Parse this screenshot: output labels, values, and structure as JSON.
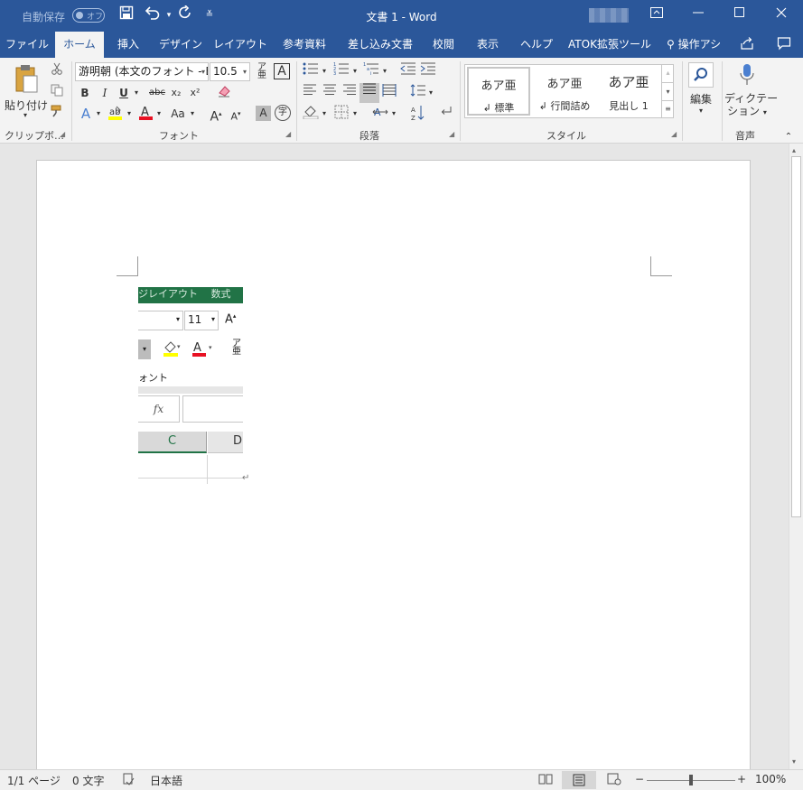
{
  "titlebar": {
    "autosave_label": "自動保存",
    "autosave_state": "オフ",
    "title": "文書 1  -  Word",
    "icons": {
      "save": "save-icon",
      "undo": "undo-icon",
      "redo": "redo-icon",
      "customize": "customize-quick-access-icon",
      "ribbon_display": "ribbon-display-options-icon",
      "minimize": "minimize-icon",
      "maximize": "maximize-icon",
      "close": "close-icon"
    }
  },
  "tabs": [
    {
      "label": "ファイル"
    },
    {
      "label": "ホーム",
      "active": true
    },
    {
      "label": "挿入"
    },
    {
      "label": "デザイン"
    },
    {
      "label": "レイアウト"
    },
    {
      "label": "参考資料"
    },
    {
      "label": "差し込み文書"
    },
    {
      "label": "校閲"
    },
    {
      "label": "表示"
    },
    {
      "label": "ヘルプ"
    },
    {
      "label": "ATOK拡張ツール"
    },
    {
      "label": "操作アシ"
    }
  ],
  "ribbon": {
    "clipboard": {
      "paste_label": "貼り付け",
      "group_label": "クリップボ…"
    },
    "font": {
      "font_name": "游明朝 (本文のフォント - E",
      "font_size": "10.5",
      "group_label": "フォント",
      "bold": "B",
      "italic": "I",
      "underline": "U",
      "strike": "abc",
      "subscript": "x₂",
      "superscript": "x²",
      "change_case": "Aa",
      "grow": "A",
      "shrink": "A",
      "char_border": "A",
      "enclose": "字"
    },
    "paragraph": {
      "group_label": "段落"
    },
    "styles": {
      "group_label": "スタイル",
      "items": [
        {
          "sample": "あア亜",
          "label": "↲ 標準"
        },
        {
          "sample": "あア亜",
          "label": "↲ 行間詰め"
        },
        {
          "sample": "あア亜",
          "label": "見出し 1"
        }
      ]
    },
    "editing": {
      "label": "編集"
    },
    "voice": {
      "label_line1": "ディクテー",
      "label_line2": "ション",
      "group_label": "音声"
    }
  },
  "embedded_image": {
    "green_text": "ジレイアウト　 数式",
    "font_size": "11",
    "font_label": "ォント",
    "fx": "fx",
    "col_c": "C",
    "col_d": "D",
    "return_mark": "↵"
  },
  "status": {
    "page": "1/1 ページ",
    "words": "0 文字",
    "language": "日本語",
    "zoom": "100%",
    "zoom_fraction": 0.5
  },
  "colors": {
    "title_blue": "#2b579a",
    "excel_green": "#217346",
    "highlight_yellow": "#ffff00",
    "font_red": "#e81123"
  }
}
